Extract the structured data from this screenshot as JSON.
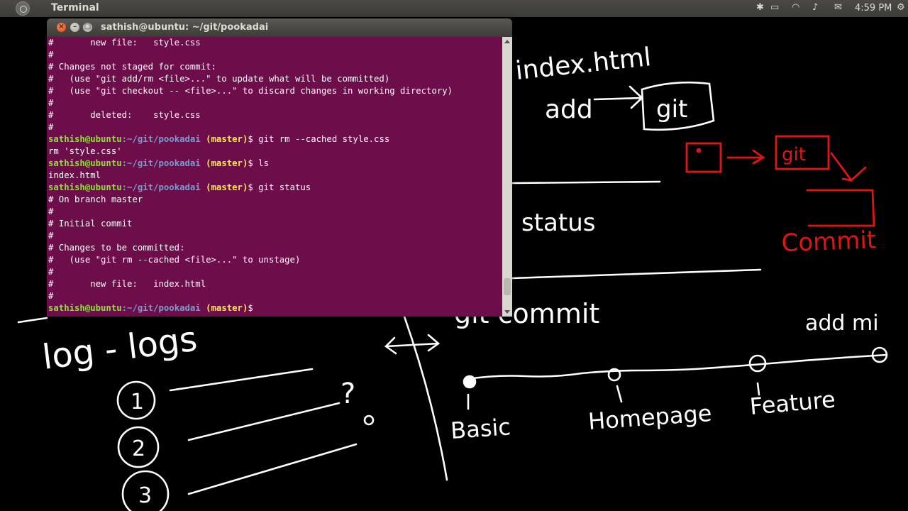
{
  "panel": {
    "app_title": "Terminal",
    "clock": "4:59 PM"
  },
  "terminal": {
    "window_title": "sathish@ubuntu: ~/git/pookadai",
    "lines": [
      {
        "type": "text",
        "text": "#       new file:   style.css"
      },
      {
        "type": "text",
        "text": "#"
      },
      {
        "type": "text",
        "text": "# Changes not staged for commit:"
      },
      {
        "type": "text",
        "text": "#   (use \"git add/rm <file>...\" to update what will be committed)"
      },
      {
        "type": "text",
        "text": "#   (use \"git checkout -- <file>...\" to discard changes in working directory)"
      },
      {
        "type": "text",
        "text": "#"
      },
      {
        "type": "text",
        "text": "#       deleted:    style.css"
      },
      {
        "type": "text",
        "text": "#"
      },
      {
        "type": "prompt",
        "user": "sathish@ubuntu",
        "path": ":~/git/pookadai",
        "branch": " (master)",
        "cmd": "$ git rm --cached style.css"
      },
      {
        "type": "text",
        "text": "rm 'style.css'"
      },
      {
        "type": "prompt",
        "user": "sathish@ubuntu",
        "path": ":~/git/pookadai",
        "branch": " (master)",
        "cmd": "$ ls"
      },
      {
        "type": "text",
        "text": "index.html"
      },
      {
        "type": "prompt",
        "user": "sathish@ubuntu",
        "path": ":~/git/pookadai",
        "branch": " (master)",
        "cmd": "$ git status"
      },
      {
        "type": "text",
        "text": "# On branch master"
      },
      {
        "type": "text",
        "text": "#"
      },
      {
        "type": "text",
        "text": "# Initial commit"
      },
      {
        "type": "text",
        "text": "#"
      },
      {
        "type": "text",
        "text": "# Changes to be committed:"
      },
      {
        "type": "text",
        "text": "#   (use \"git rm --cached <file>...\" to unstage)"
      },
      {
        "type": "text",
        "text": "#"
      },
      {
        "type": "text",
        "text": "#       new file:   index.html"
      },
      {
        "type": "text",
        "text": "#"
      },
      {
        "type": "prompt",
        "user": "sathish@ubuntu",
        "path": ":~/git/pookadai",
        "branch": " (master)",
        "cmd": "$ "
      }
    ]
  },
  "board": {
    "notes": {
      "index": "index.html",
      "add": "add",
      "git_box": "git",
      "red_git": "git",
      "red_commit": "Commit",
      "status": "status",
      "git_commit": "git commit",
      "add_mi": "add mi",
      "log": "log - logs",
      "n1": "1",
      "n2": "2",
      "n3": "3",
      "question": "?",
      "basic": "Basic",
      "homepage": "Homepage",
      "feature": "Feature"
    }
  },
  "colors": {
    "terminal_bg": "#6d0e4a",
    "prompt_user": "#8ae234",
    "prompt_path": "#729fcf",
    "ink_white": "#ffffff",
    "ink_red": "#e01414"
  }
}
